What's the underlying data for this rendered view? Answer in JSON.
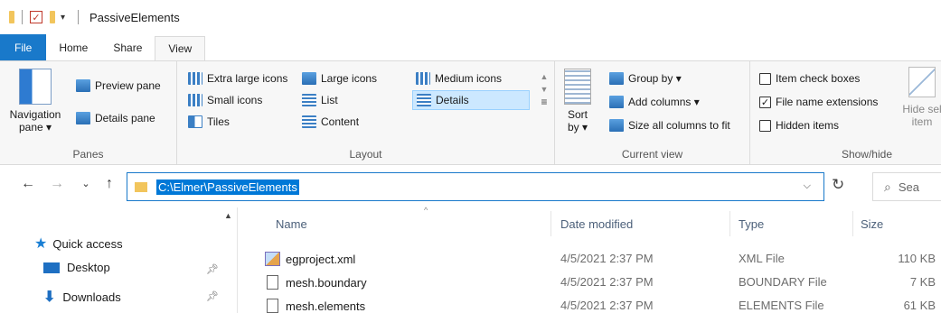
{
  "window": {
    "title": "PassiveElements"
  },
  "tabs": [
    "File",
    "Home",
    "Share",
    "View"
  ],
  "ribbon": {
    "panes": {
      "navigation_pane": "Navigation",
      "navigation_pane_line2": "pane",
      "preview_pane": "Preview pane",
      "details_pane": "Details pane",
      "group_label": "Panes"
    },
    "layout": {
      "items": [
        "Extra large icons",
        "Large icons",
        "Medium icons",
        "Small icons",
        "List",
        "Details",
        "Tiles",
        "Content"
      ],
      "selected": "Details",
      "group_label": "Layout"
    },
    "current_view": {
      "sort_by": "Sort",
      "sort_by_line2": "by",
      "group_by": "Group by",
      "add_columns": "Add columns",
      "size_all": "Size all columns to fit",
      "group_label": "Current view"
    },
    "show_hide": {
      "item_check_boxes": "Item check boxes",
      "file_name_extensions": "File name extensions",
      "hidden_items": "Hidden items",
      "hide_selected": "Hide sel",
      "hide_selected_line2": "item",
      "group_label": "Show/hide",
      "checks": {
        "item_check_boxes": false,
        "file_name_extensions": true,
        "hidden_items": false
      }
    }
  },
  "address": {
    "path": "C:\\Elmer\\PassiveElements",
    "search_placeholder": "Sea"
  },
  "nav": {
    "quick_access": "Quick access",
    "items": [
      "Desktop",
      "Downloads"
    ]
  },
  "columns": [
    "Name",
    "Date modified",
    "Type",
    "Size"
  ],
  "files": [
    {
      "name": "egproject.xml",
      "date": "4/5/2021 2:37 PM",
      "type": "XML File",
      "size": "110 KB",
      "icon": "xml-file-icon"
    },
    {
      "name": "mesh.boundary",
      "date": "4/5/2021 2:37 PM",
      "type": "BOUNDARY File",
      "size": "7 KB",
      "icon": "file-icon"
    },
    {
      "name": "mesh.elements",
      "date": "4/5/2021 2:37 PM",
      "type": "ELEMENTS File",
      "size": "61 KB",
      "icon": "file-icon"
    }
  ]
}
